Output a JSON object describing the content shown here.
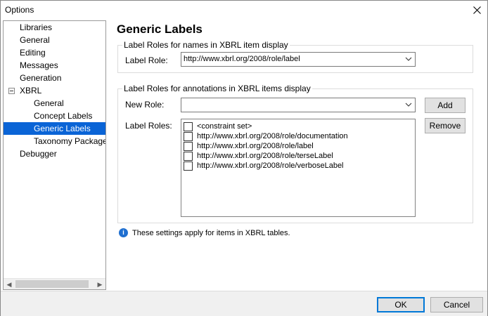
{
  "window": {
    "title": "Options"
  },
  "tree": {
    "items": [
      {
        "label": "Libraries"
      },
      {
        "label": "General"
      },
      {
        "label": "Editing"
      },
      {
        "label": "Messages"
      },
      {
        "label": "Generation"
      },
      {
        "label": "XBRL"
      },
      {
        "label": "General"
      },
      {
        "label": "Concept Labels"
      },
      {
        "label": "Generic Labels"
      },
      {
        "label": "Taxonomy Package"
      },
      {
        "label": "Debugger"
      }
    ],
    "selected": "Generic Labels"
  },
  "main": {
    "title": "Generic Labels",
    "group1": {
      "title": "Label Roles for names in XBRL item display",
      "label_role_label": "Label Role:",
      "label_role_value": "http://www.xbrl.org/2008/role/label"
    },
    "group2": {
      "title": "Label Roles for annotations in XBRL items display",
      "new_role_label": "New Role:",
      "new_role_value": "",
      "label_roles_label": "Label Roles:",
      "add_button": "Add",
      "remove_button": "Remove",
      "roles": [
        {
          "label": "<constraint set>",
          "checked": false
        },
        {
          "label": "http://www.xbrl.org/2008/role/documentation",
          "checked": false
        },
        {
          "label": "http://www.xbrl.org/2008/role/label",
          "checked": false
        },
        {
          "label": "http://www.xbrl.org/2008/role/terseLabel",
          "checked": false
        },
        {
          "label": "http://www.xbrl.org/2008/role/verboseLabel",
          "checked": false
        }
      ]
    },
    "info": {
      "icon": "info-icon",
      "text": "These settings apply for items in XBRL tables."
    }
  },
  "footer": {
    "ok_button": "OK",
    "cancel_button": "Cancel"
  },
  "colors": {
    "selection": "#0a64d6",
    "info_icon": "#1f6fd0",
    "default_button_border": "#0078d7"
  }
}
